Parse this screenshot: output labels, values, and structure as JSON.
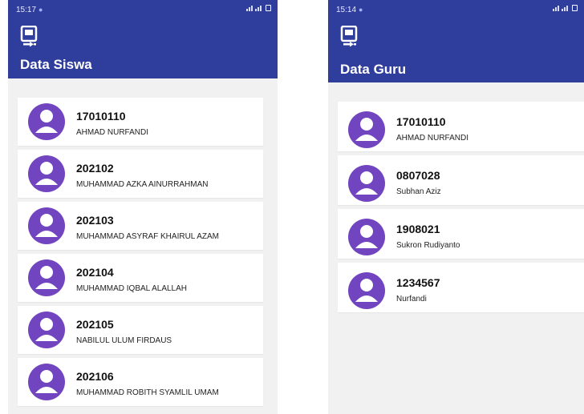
{
  "left_screen": {
    "status_time": "15:17",
    "title": "Data Siswa",
    "items": [
      {
        "id": "17010110",
        "name": "AHMAD NURFANDI"
      },
      {
        "id": "202102",
        "name": "MUHAMMAD AZKA AINURRAHMAN"
      },
      {
        "id": "202103",
        "name": "MUHAMMAD ASYRAF KHAIRUL AZAM"
      },
      {
        "id": "202104",
        "name": "MUHAMMAD IQBAL ALALLAH"
      },
      {
        "id": "202105",
        "name": "NABILUL ULUM FIRDAUS"
      },
      {
        "id": "202106",
        "name": "MUHAMMAD ROBITH SYAMLIL UMAM"
      }
    ]
  },
  "right_screen": {
    "status_time": "15:14",
    "title": "Data Guru",
    "items": [
      {
        "id": "17010110",
        "name": "AHMAD NURFANDI"
      },
      {
        "id": "0807028",
        "name": "Subhan Aziz"
      },
      {
        "id": "1908021",
        "name": "Sukron Rudiyanto"
      },
      {
        "id": "1234567",
        "name": "Nurfandi"
      }
    ]
  },
  "icons": {
    "app": "badge-icon",
    "avatar": "user-avatar-icon",
    "wifi": "wifi-icon",
    "signal": "signal-icon",
    "battery": "battery-icon"
  },
  "colors": {
    "appbar": "#2f3d9d",
    "avatar": "#7144c0",
    "background": "#f1f1f1"
  }
}
